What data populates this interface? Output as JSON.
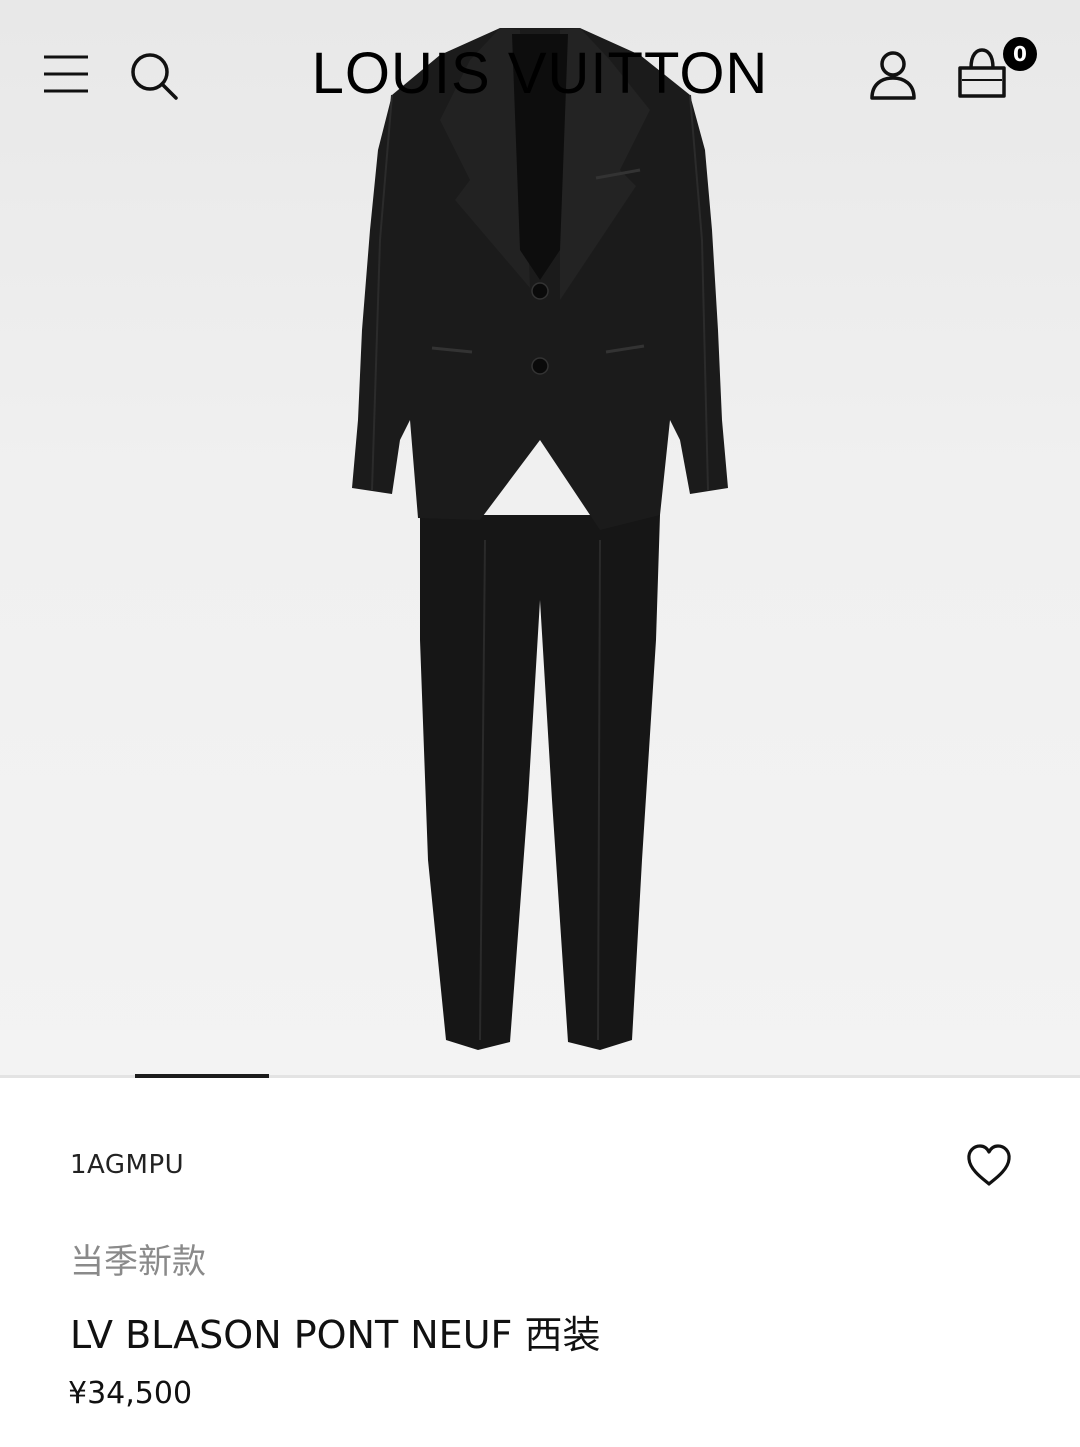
{
  "header": {
    "brand": "LOUIS VUITTON",
    "bag_count": "0",
    "icons": [
      "menu-icon",
      "search-icon",
      "account-icon",
      "shopping-bag-icon"
    ]
  },
  "carousel": {
    "active_index": 1
  },
  "product": {
    "sku": "1AGMPU",
    "season_tag": "当季新款",
    "name": "LV BLASON PONT NEUF 西装",
    "price": "¥34,500",
    "wishlist_icon": "heart-icon"
  },
  "colors": {
    "suit": "#1a1a1a",
    "background": "#efefef",
    "badge": "#000000"
  }
}
